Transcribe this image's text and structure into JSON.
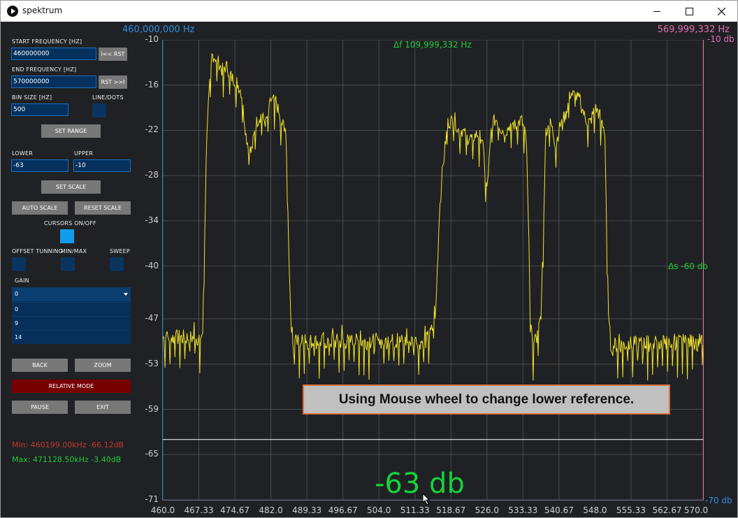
{
  "window": {
    "title": "spektrum"
  },
  "colors": {
    "background": "#202124",
    "trace": "#f0e42a",
    "field_bg": "#06315e",
    "relative_mode_button": "#780000",
    "toggle_on": "#0f9cec",
    "min_text": "#c0392b",
    "max_text": "#1fcc3a",
    "accent_green": "#15d33a",
    "start_marker": "#2f8de0",
    "end_marker": "#e46fb4"
  },
  "panel": {
    "start_freq": {
      "label": "START FREQUENCY [HZ]",
      "value": "460000000",
      "button": "I<< RST"
    },
    "end_freq": {
      "label": "END FREQUENCY [HZ]",
      "value": "570000000",
      "button": "RST >>I"
    },
    "bin_size": {
      "label": "BIN SIZE [HZ]",
      "value": "500"
    },
    "line_dots": {
      "label": "LINE/DOTS"
    },
    "set_range": "SET RANGE",
    "lower": {
      "label": "LOWER",
      "value": "-63"
    },
    "upper": {
      "label": "UPPER",
      "value": "-10"
    },
    "set_scale": "SET SCALE",
    "auto_scale": "AUTO SCALE",
    "reset_scale": "RESET SCALE",
    "cursors": {
      "label": "CURSORS ON/OFF",
      "on": true
    },
    "offset_tuning": "OFFSET TUNNING",
    "min_max": "MIN/MAX",
    "sweep": "SWEEP",
    "gain": {
      "label": "GAIN",
      "selected": "0",
      "options": [
        "0",
        "9",
        "14"
      ]
    },
    "back": "BACK",
    "zoom": "ZOOM",
    "relative_mode": "RELATIVE MODE",
    "pause": "PAUSE",
    "exit": "EXIT",
    "min_text": "Min: 460199.00kHz -66.12dB",
    "max_text": "Max: 471128.50kHz -3.40dB"
  },
  "plot": {
    "start_marker": "460,000,000 Hz",
    "end_marker": "569,999,332 Hz",
    "right_top": "-10 db",
    "right_bottom": "-70 db",
    "delta_f": "Δf 109,999,332 Hz",
    "delta_s": "Δs -60 db",
    "big_readout": "-63 db",
    "tooltip": "Using Mouse wheel to change lower reference.",
    "y_ticks": [
      "-10",
      "-16",
      "-22",
      "-28",
      "-34",
      "-40",
      "-47",
      "-53",
      "-59",
      "-65",
      "-71"
    ],
    "x_ticks": [
      "460.0",
      "467.33",
      "474.67",
      "482.0",
      "489.33",
      "496.67",
      "504.0",
      "511.33",
      "518.67",
      "526.0",
      "533.33",
      "540.67",
      "548.0",
      "555.33",
      "562.67",
      "570.0"
    ]
  },
  "chart_data": {
    "type": "line",
    "xlabel": "",
    "ylabel": "",
    "xlim": [
      460.0,
      570.0
    ],
    "ylim": [
      -71,
      -10
    ],
    "reference_level_db": -63,
    "series": [
      {
        "x": [
          460.0,
          467.5,
          468.1,
          469.0,
          470.0,
          471.0,
          472.0,
          473.0,
          474.0,
          475.0,
          476.0,
          477.0,
          478.0,
          479.0,
          480.0,
          481.0,
          482.0,
          483.0,
          484.0,
          485.0,
          486.0,
          486.5,
          487.0,
          505.0,
          513.5,
          514.5,
          515.5,
          516.5,
          518.0,
          519.5,
          520.0,
          521.0,
          522.0,
          523.0,
          524.0,
          525.0,
          526.0,
          527.0,
          528.0,
          529.0,
          530.0,
          531.0,
          532.0,
          533.0,
          534.0,
          535.0,
          536.0,
          537.0,
          538.0,
          539.0,
          540.0,
          541.0,
          542.0,
          543.0,
          544.0,
          545.0,
          546.0,
          547.0,
          548.0,
          549.0,
          550.0,
          550.5,
          551.0,
          570.0
        ],
        "y": [
          -49.5,
          -49.5,
          -49,
          -21,
          -12,
          -12.5,
          -14,
          -13.5,
          -15,
          -15.5,
          -17,
          -23,
          -25,
          -21,
          -20,
          -21,
          -18,
          -18,
          -21,
          -21.5,
          -46,
          -50.5,
          -50,
          -50,
          -50,
          -49,
          -47,
          -30,
          -21,
          -20.5,
          -22,
          -22,
          -23,
          -23,
          -22.5,
          -23,
          -30,
          -21,
          -20.5,
          -22,
          -22,
          -21,
          -21.5,
          -20.5,
          -23,
          -49.5,
          -50,
          -47,
          -22,
          -21,
          -24,
          -21,
          -20,
          -17,
          -17.5,
          -18,
          -20.5,
          -21,
          -19,
          -20,
          -22,
          -40,
          -50.5,
          -50
        ]
      }
    ]
  }
}
